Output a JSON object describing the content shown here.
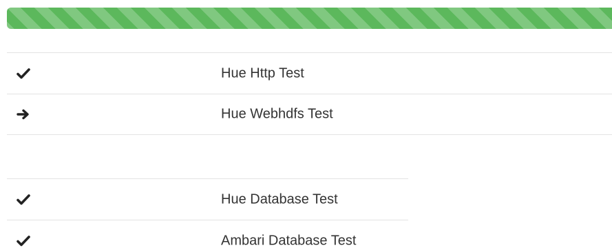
{
  "progress": {
    "fraction": 1.0,
    "color": "#5cb85c"
  },
  "groups": [
    {
      "rows": [
        {
          "icon": "checkmark-icon",
          "label": "Hue Http Test"
        },
        {
          "icon": "arrow-right-icon",
          "label": "Hue Webhdfs Test"
        }
      ]
    },
    {
      "rows": [
        {
          "icon": "checkmark-icon",
          "label": "Hue Database Test"
        },
        {
          "icon": "checkmark-icon",
          "label": "Ambari Database Test"
        }
      ]
    }
  ]
}
